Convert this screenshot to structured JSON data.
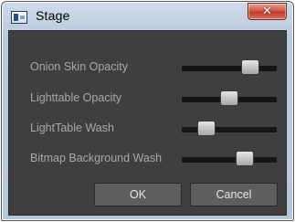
{
  "window": {
    "title": "Stage",
    "app_icon": "stage-app-icon",
    "close_icon": "close-x-icon",
    "close_glyph": "✕"
  },
  "sliders": [
    {
      "label": "Onion Skin Opacity",
      "value": 0.72
    },
    {
      "label": "Lighttable Opacity",
      "value": 0.5
    },
    {
      "label": "LightTable Wash",
      "value": 0.26
    },
    {
      "label": "Bitmap Background Wash",
      "value": 0.66
    }
  ],
  "buttons": {
    "ok_label": "OK",
    "cancel_label": "Cancel"
  },
  "colors": {
    "panel": "#3f3f3f",
    "label_text": "#a8a8a8",
    "track": "#161616",
    "button": "#5e5e5e",
    "close_red": "#c03a28"
  }
}
